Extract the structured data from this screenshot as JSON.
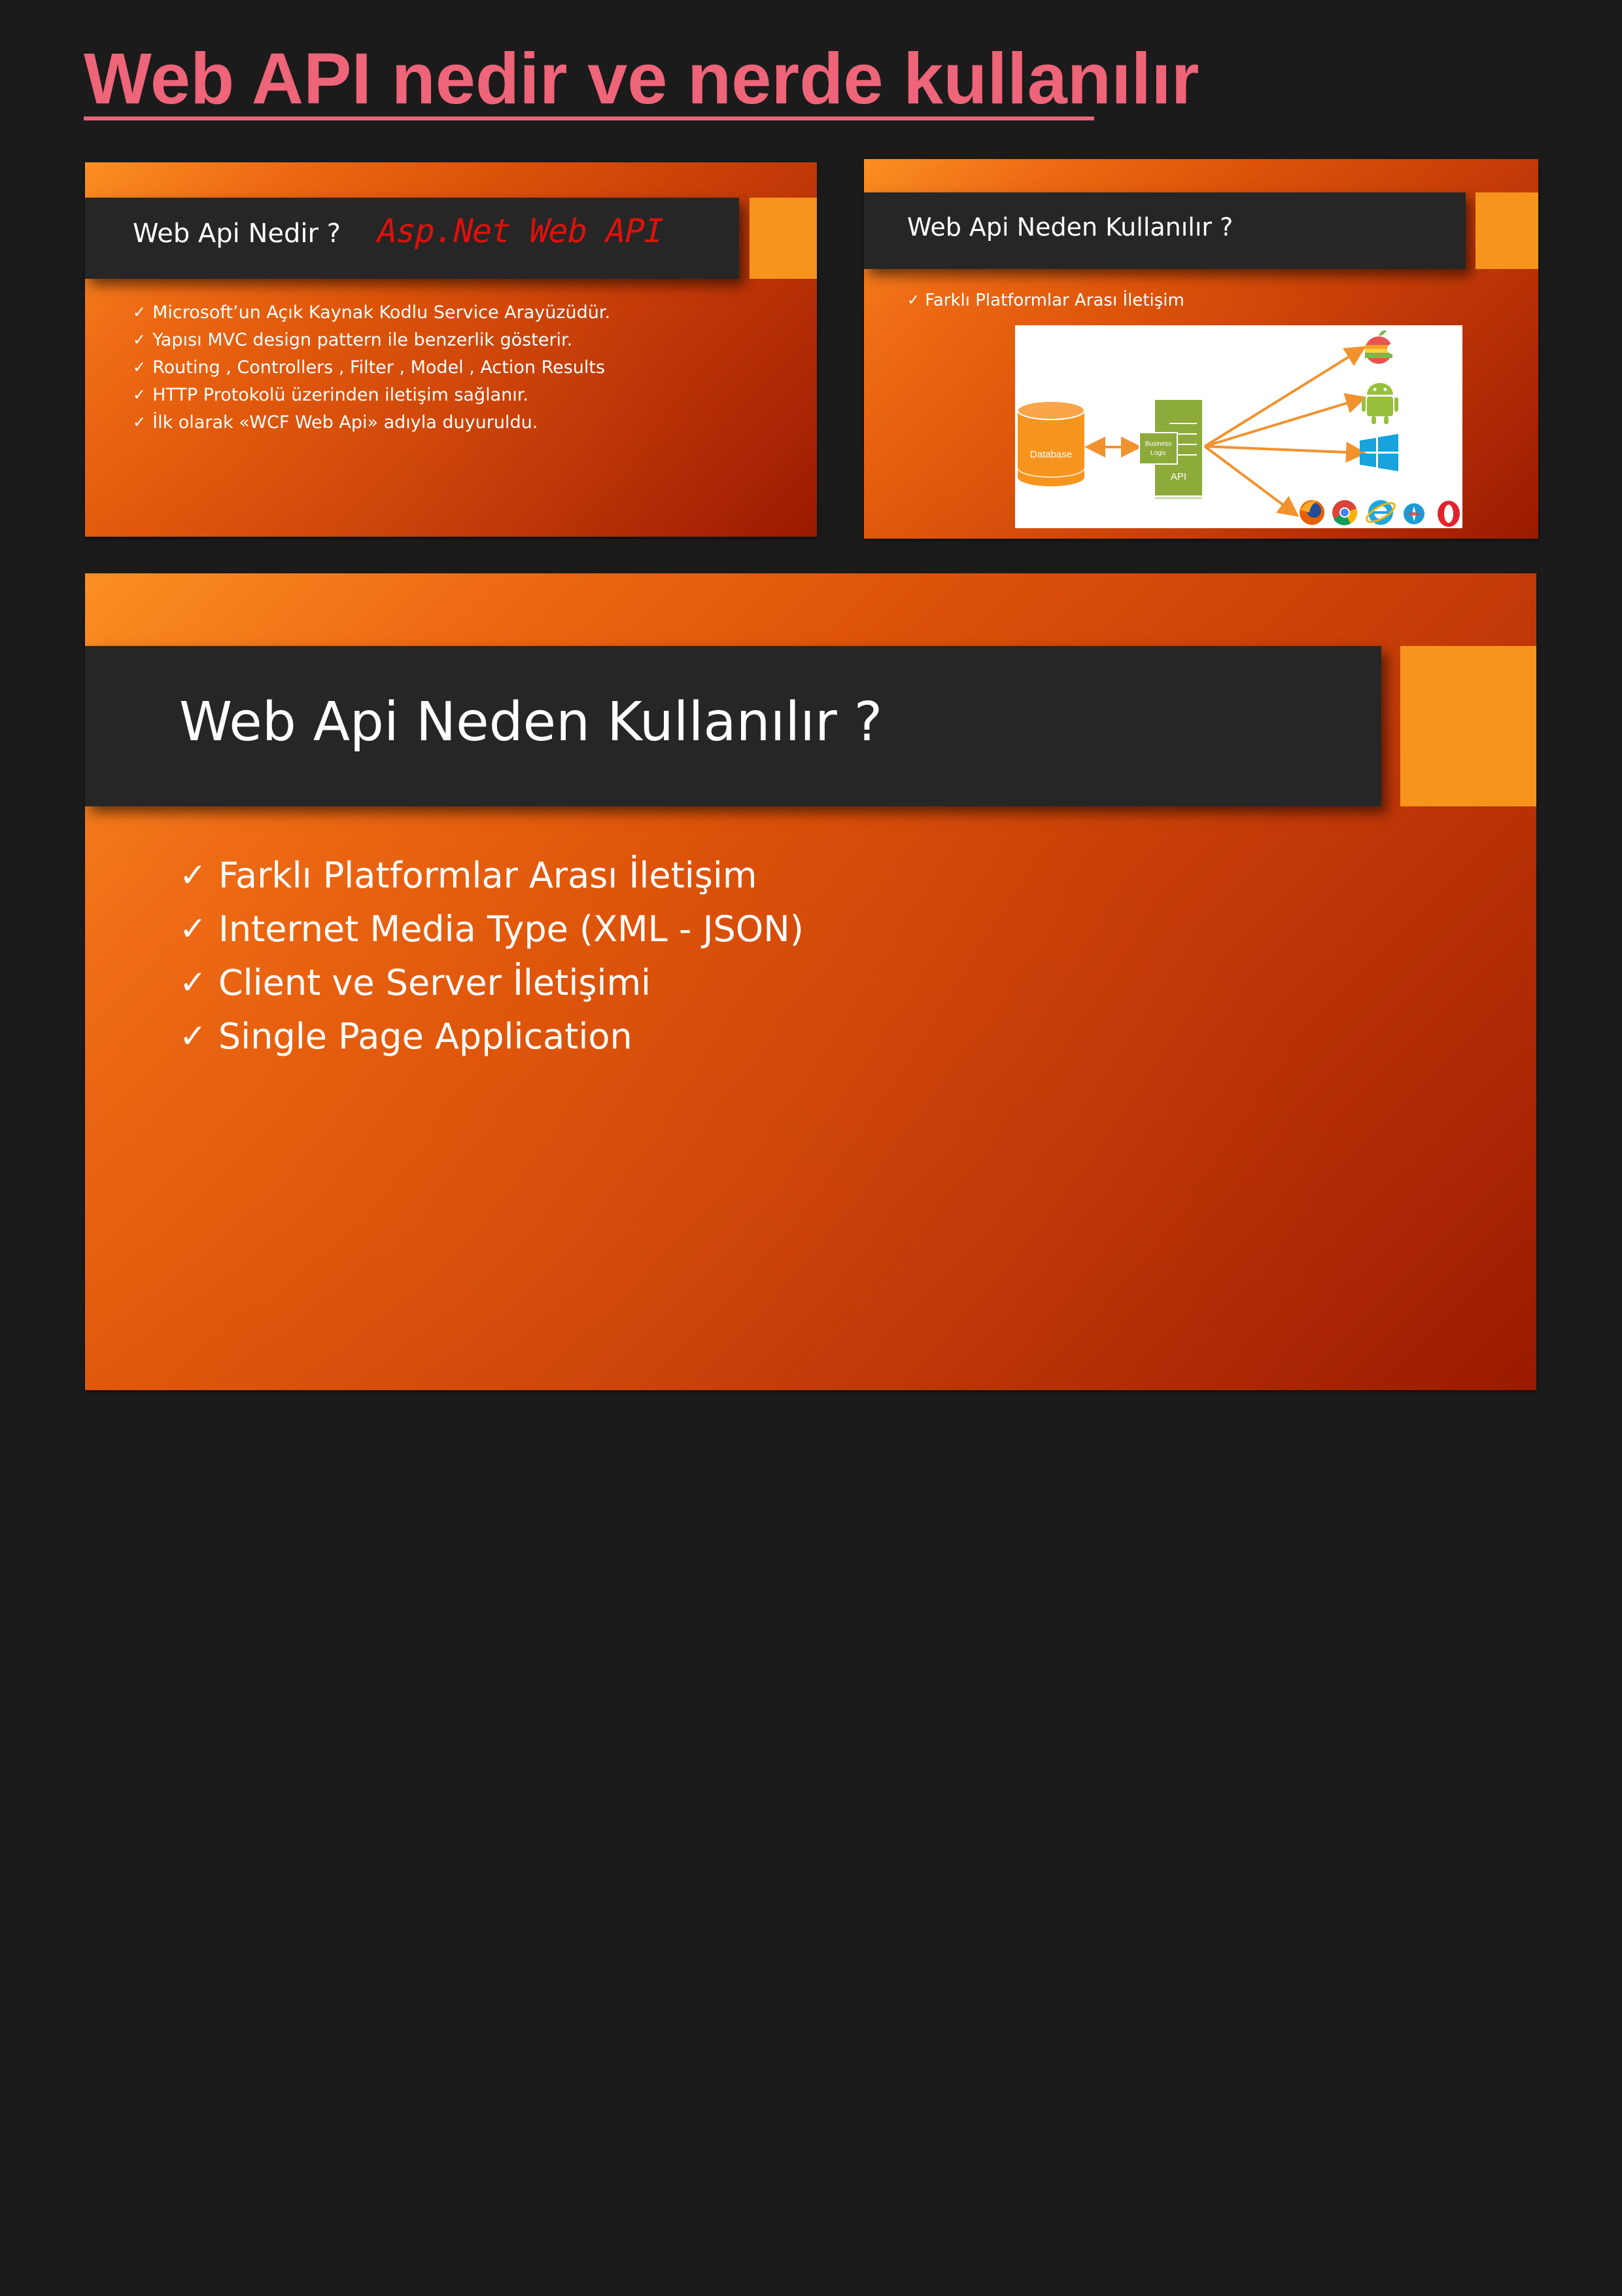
{
  "page": {
    "title": "Web API nedir ve nerde kullanılır"
  },
  "slides": [
    {
      "title": "Web Api Nedir ?",
      "annotation": "Asp.Net Web API",
      "bullets": [
        "Microsoft’un Açık Kaynak Kodlu Service Arayüzüdür.",
        "Yapısı MVC design pattern ile benzerlik gösterir.",
        "Routing , Controllers , Filter , Model , Action Results",
        "HTTP Protokolü üzerinden iletişim sağlanır.",
        "İlk olarak «WCF Web Api» adıyla duyuruldu."
      ]
    },
    {
      "title": "Web Api Neden Kullanılır ?",
      "bullets": [
        "Farklı Platformlar Arası İletişim"
      ],
      "diagram": {
        "database_label": "Database",
        "logic_label_line1": "Business",
        "logic_label_line2": "Logic",
        "api_label": "API",
        "clients": [
          "apple-icon",
          "android-icon",
          "windows-icon",
          "firefox-icon",
          "chrome-icon",
          "ie-icon",
          "safari-icon",
          "opera-icon"
        ]
      }
    },
    {
      "title": "Web Api Neden Kullanılır ?",
      "bullets": [
        "Farklı Platformlar Arası İletişim",
        "Internet Media Type (XML - JSON)",
        "Client ve Server İletişimi",
        "Single Page Application"
      ]
    }
  ],
  "check_mark": "✓",
  "colors": {
    "page_background": "#1b1b1b",
    "page_title": "#ee6478",
    "title_bar": "#262626",
    "accent_square": "#f7941d",
    "slide_gradient_start": "#fb8f22",
    "slide_gradient_end": "#9a1a01",
    "annotation": "#e0100a",
    "database": "#f7941d",
    "api_block": "#8cab3b",
    "arrow": "#f2922f"
  }
}
